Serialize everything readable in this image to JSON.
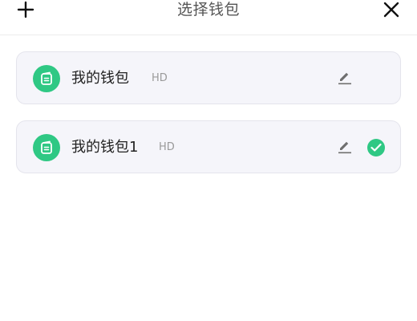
{
  "header": {
    "title": "选择钱包"
  },
  "wallets": [
    {
      "name": "我的钱包",
      "tag": "HD",
      "selected": false
    },
    {
      "name": "我的钱包1",
      "tag": "HD",
      "selected": true
    }
  ],
  "colors": {
    "accent": "#2fc884",
    "card_bg": "#f5f5fa",
    "card_border": "#e4e4ec",
    "tag_text": "#9a9a9a",
    "title_text": "#555555"
  },
  "icons": {
    "add": "plus-icon",
    "close": "close-icon",
    "wallet": "wallet-icon",
    "edit": "edit-pencil-icon",
    "selected": "check-circle-icon"
  }
}
